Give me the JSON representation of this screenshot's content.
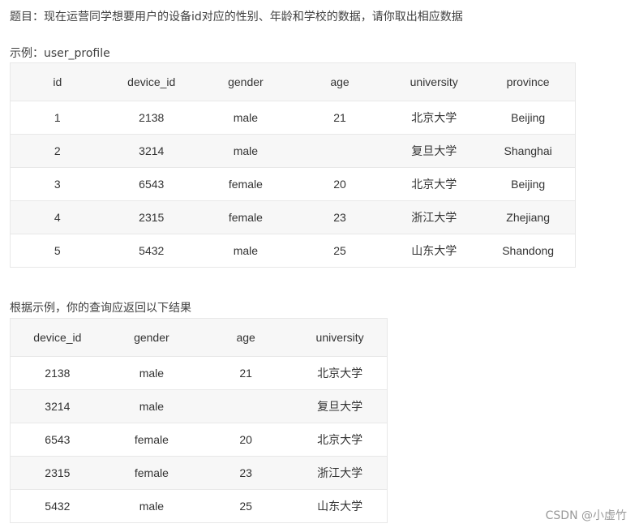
{
  "question": "题目：现在运营同学想要用户的设备id对应的性别、年龄和学校的数据，请你取出相应数据",
  "example_label": "示例：user_profile",
  "example_table": {
    "headers": [
      "id",
      "device_id",
      "gender",
      "age",
      "university",
      "province"
    ],
    "rows": [
      [
        "1",
        "2138",
        "male",
        "21",
        "北京大学",
        "Beijing"
      ],
      [
        "2",
        "3214",
        "male",
        "",
        "复旦大学",
        "Shanghai"
      ],
      [
        "3",
        "6543",
        "female",
        "20",
        "北京大学",
        "Beijing"
      ],
      [
        "4",
        "2315",
        "female",
        "23",
        "浙江大学",
        "Zhejiang"
      ],
      [
        "5",
        "5432",
        "male",
        "25",
        "山东大学",
        "Shandong"
      ]
    ]
  },
  "result_label": "根据示例，你的查询应返回以下结果",
  "result_table": {
    "headers": [
      "device_id",
      "gender",
      "age",
      "university"
    ],
    "rows": [
      [
        "2138",
        "male",
        "21",
        "北京大学"
      ],
      [
        "3214",
        "male",
        "",
        "复旦大学"
      ],
      [
        "6543",
        "female",
        "20",
        "北京大学"
      ],
      [
        "2315",
        "female",
        "23",
        "浙江大学"
      ],
      [
        "5432",
        "male",
        "25",
        "山东大学"
      ]
    ]
  },
  "watermark": "CSDN @小虚竹"
}
